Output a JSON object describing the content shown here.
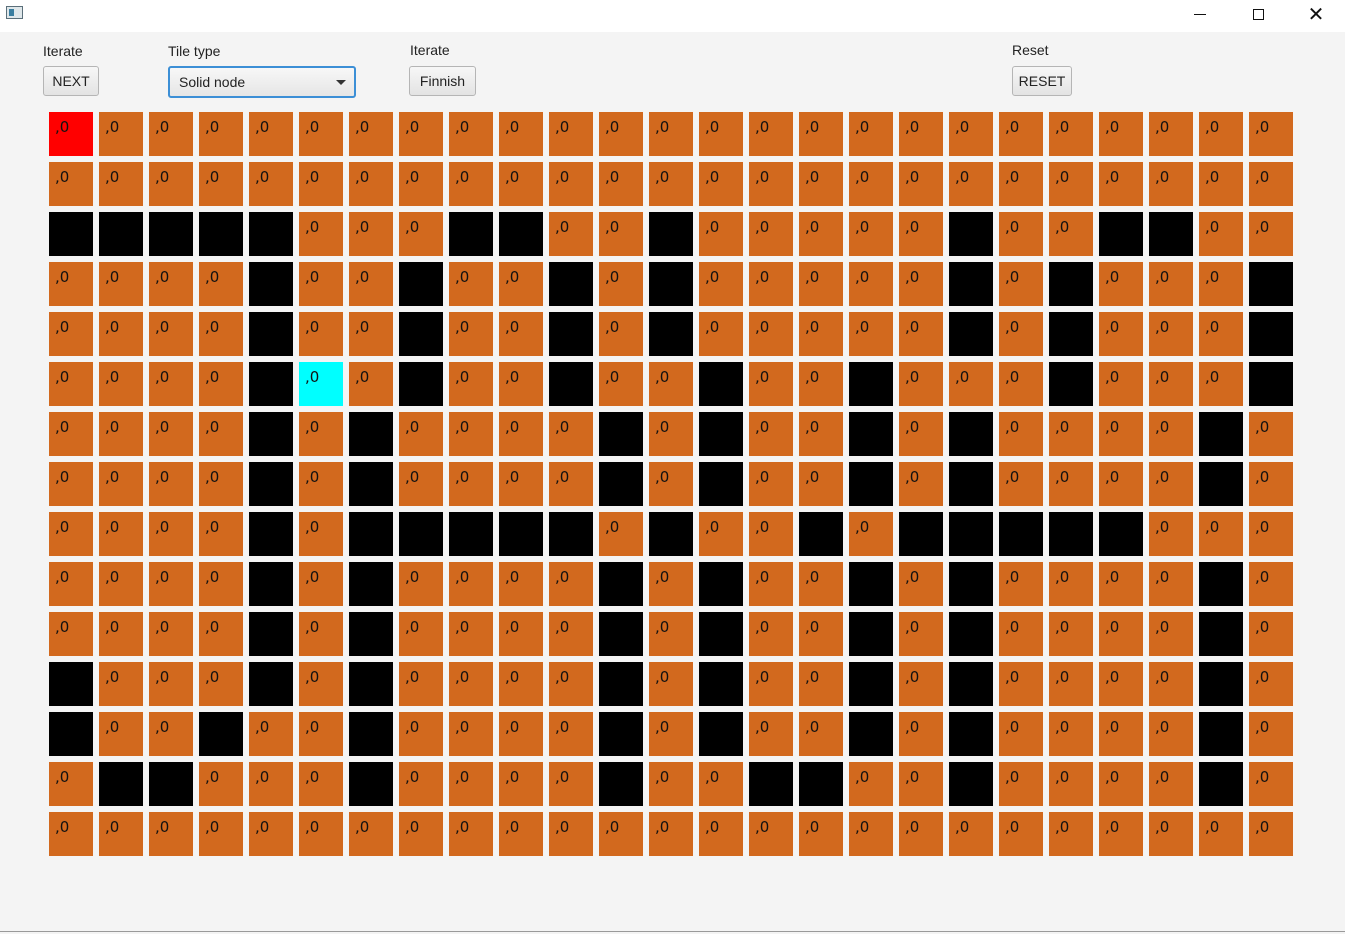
{
  "window": {
    "icons": {
      "app": "app-window-icon",
      "minimize": "minimize-icon",
      "maximize": "maximize-icon",
      "close": "close-icon"
    }
  },
  "controls": {
    "iterate_label_1": "Iterate",
    "next_button": "NEXT",
    "tile_type_label": "Tile type",
    "tile_type_value": "Solid node",
    "iterate_label_2": "Iterate",
    "finish_button": "Finnish",
    "reset_label": "Reset",
    "reset_button": "RESET"
  },
  "grid": {
    "cell_text": ",0",
    "legend": {
      ".": "open (orange #d2691e)",
      "#": "solid (black #000000)",
      "S": "start (red #ff0000)",
      "G": "goal (cyan #00ffff)"
    },
    "rows": [
      "S........................",
      ".........................",
      "#####...##..#.....#..##...",
      "....#..#..#.#.....#.#...#..",
      "....#..#..#.#.....#.#...#..",
      "....#G.#..#..#..#...#...#..",
      "....#.#....#.#..#.#....#.",
      "....#.#....#.#..#.#....#.",
      "....#.#####.#..#.#####.",
      "....#.#....#.#..#.#....#.",
      "....#.#....#.#..#.#....#.",
      "#...#.#....#.#..#.#....#.",
      "#..#..#....#.#..#.#....#.",
      ".##...#....#..##..#....#.",
      "........................."
    ]
  }
}
